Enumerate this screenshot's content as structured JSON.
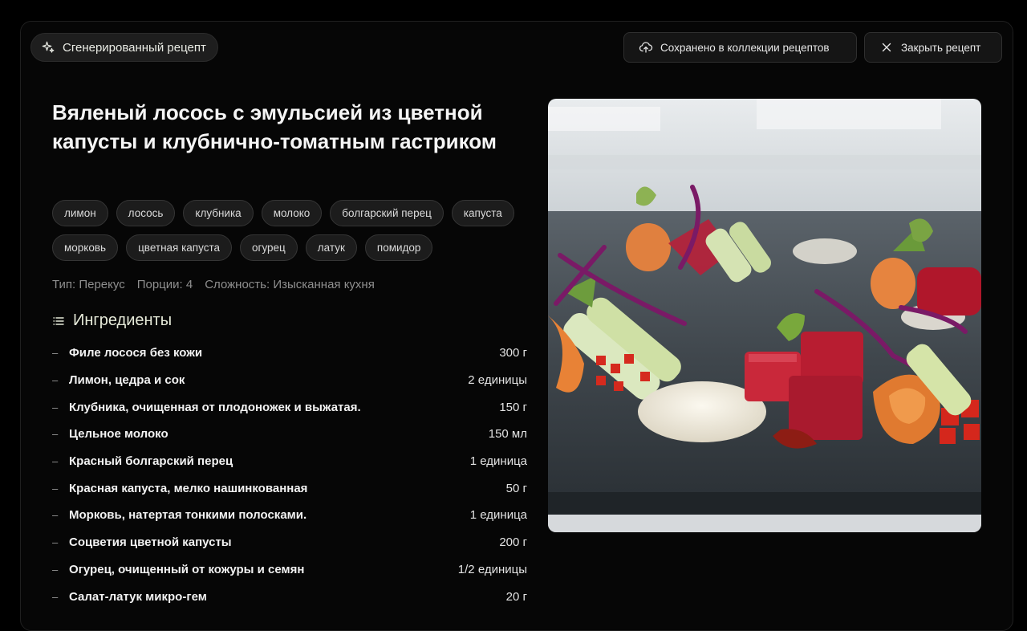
{
  "header": {
    "badge_label": "Сгенерированный рецепт",
    "saved_label": "Сохранено в коллекции рецептов",
    "close_label": "Закрыть рецепт"
  },
  "recipe": {
    "title": "Вяленый лосось с эмульсией из цветной капусты и клубнично-томатным гастриком",
    "tags": [
      "лимон",
      "лосось",
      "клубника",
      "молоко",
      "болгарский перец",
      "капуста",
      "морковь",
      "цветная капуста",
      "огурец",
      "латук",
      "помидор"
    ],
    "meta": {
      "type": "Тип: Перекус",
      "portions": "Порции: 4",
      "difficulty": "Сложность: Изысканная кухня"
    }
  },
  "ingredients": {
    "title": "Ингредиенты",
    "items": [
      {
        "name": "Филе лосося без кожи",
        "qty": "300 г"
      },
      {
        "name": "Лимон, цедра и сок",
        "qty": "2 единицы"
      },
      {
        "name": "Клубника, очищенная от плодоножек и выжатая.",
        "qty": "150 г"
      },
      {
        "name": "Цельное молоко",
        "qty": "150 мл"
      },
      {
        "name": "Красный болгарский перец",
        "qty": "1 единица"
      },
      {
        "name": "Красная капуста, мелко нашинкованная",
        "qty": "50 г"
      },
      {
        "name": "Морковь, натертая тонкими полосками.",
        "qty": "1 единица"
      },
      {
        "name": "Соцветия цветной капусты",
        "qty": "200 г"
      },
      {
        "name": "Огурец, очищенный от кожуры и семян",
        "qty": "1/2 единицы"
      },
      {
        "name": "Салат-латук микро-гем",
        "qty": "20 г"
      }
    ]
  },
  "icons": {
    "badge": "sparkle-icon",
    "saved": "cloud-upload-icon",
    "close": "close-icon",
    "ingredients": "list-icon"
  },
  "colors": {
    "background": "#000000",
    "panel": "#060606",
    "badge_text": "#e9ebe4"
  }
}
